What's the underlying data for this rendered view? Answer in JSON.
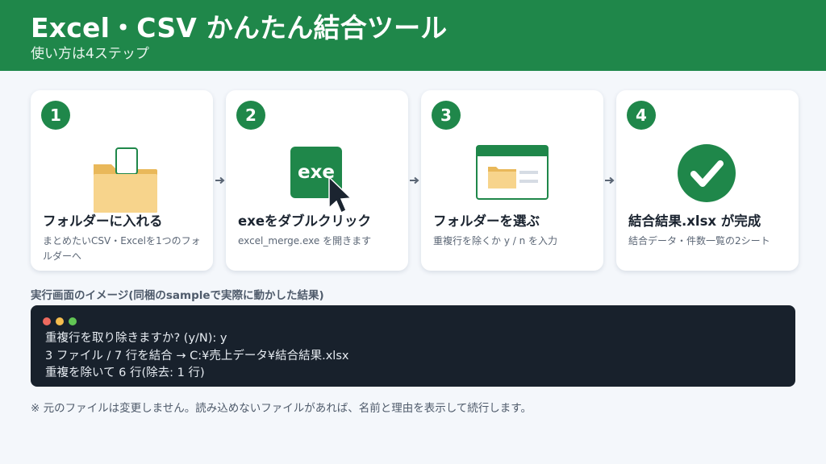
{
  "header": {
    "title": "Excel・CSV かんたん結合ツール",
    "subtitle": "使い方は4ステップ"
  },
  "colors": {
    "brand": "#1f874a",
    "terminal_bg": "#18212c",
    "folder": "#f7d48c",
    "cursor": "#1b2430"
  },
  "steps": [
    {
      "number": "1",
      "icon": "folder-with-document-icon",
      "title": "フォルダーに入れる",
      "desc": "まとめたいCSV・Excelを1つのフォルダーへ"
    },
    {
      "number": "2",
      "icon": "exe-with-cursor-icon",
      "badge": "exe",
      "title": "exeをダブルクリック",
      "desc": "excel_merge.exe を開きます"
    },
    {
      "number": "3",
      "icon": "folder-window-icon",
      "title": "フォルダーを選ぶ",
      "desc": "重複行を除くか y / n を入力"
    },
    {
      "number": "4",
      "icon": "check-circle-icon",
      "title": "結合結果.xlsx が完成",
      "desc": "結合データ・件数一覧の2シート"
    }
  ],
  "terminal": {
    "label": "実行画面のイメージ(同梱のsampleで実際に動かした結果)",
    "dots": [
      "#ee6a5f",
      "#f5bd4f",
      "#61c554"
    ],
    "lines": [
      "重複行を取り除きますか? (y/N): y",
      "3 ファイル / 7 行を結合 → C:¥売上データ¥結合結果.xlsx",
      "重複を除いて 6 行(除去: 1 行)"
    ]
  },
  "note": "※ 元のファイルは変更しません。読み込めないファイルがあれば、名前と理由を表示して続行します。"
}
